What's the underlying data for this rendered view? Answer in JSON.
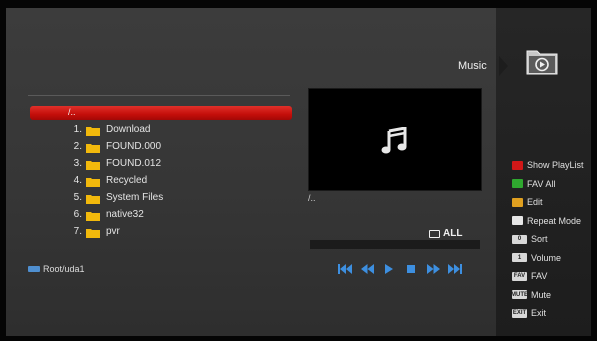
{
  "header": {
    "section_title": "Music",
    "section_icon": "music-folder-icon"
  },
  "browser": {
    "current_path": "/..",
    "files": [
      {
        "index": "1.",
        "name": "Download"
      },
      {
        "index": "2.",
        "name": "FOUND.000"
      },
      {
        "index": "3.",
        "name": "FOUND.012"
      },
      {
        "index": "4.",
        "name": "Recycled"
      },
      {
        "index": "5.",
        "name": "System Files"
      },
      {
        "index": "6.",
        "name": "native32"
      },
      {
        "index": "7.",
        "name": "pvr"
      }
    ],
    "root_path": "Root/uda1"
  },
  "preview": {
    "icon": "music-note-icon",
    "path": "/..",
    "repeat_mode": "ALL",
    "progress": 0
  },
  "playback_controls": [
    "skip-back-icon",
    "rewind-icon",
    "play-icon",
    "stop-icon",
    "fast-forward-icon",
    "skip-forward-icon"
  ],
  "legend": {
    "show_playlist": {
      "label": "Show PlayList",
      "color": "#d01818"
    },
    "fav_all": {
      "label": "FAV All",
      "color": "#2fa82f"
    },
    "edit": {
      "label": "Edit",
      "color": "#e0a020"
    },
    "repeat_mode": {
      "label": "Repeat Mode",
      "color": "#e6e6e6"
    },
    "sort": {
      "label": "Sort",
      "key": "0"
    },
    "volume": {
      "label": "Volume",
      "key": "1"
    },
    "fav": {
      "label": "FAV",
      "key": "FAV"
    },
    "mute": {
      "label": "Mute",
      "key": "MUTE"
    },
    "exit": {
      "label": "Exit",
      "key": "EXIT"
    }
  },
  "colors": {
    "accent_red": "#c40e0a",
    "folder_yellow": "#f2b90c",
    "control_blue": "#3d8fe0"
  }
}
